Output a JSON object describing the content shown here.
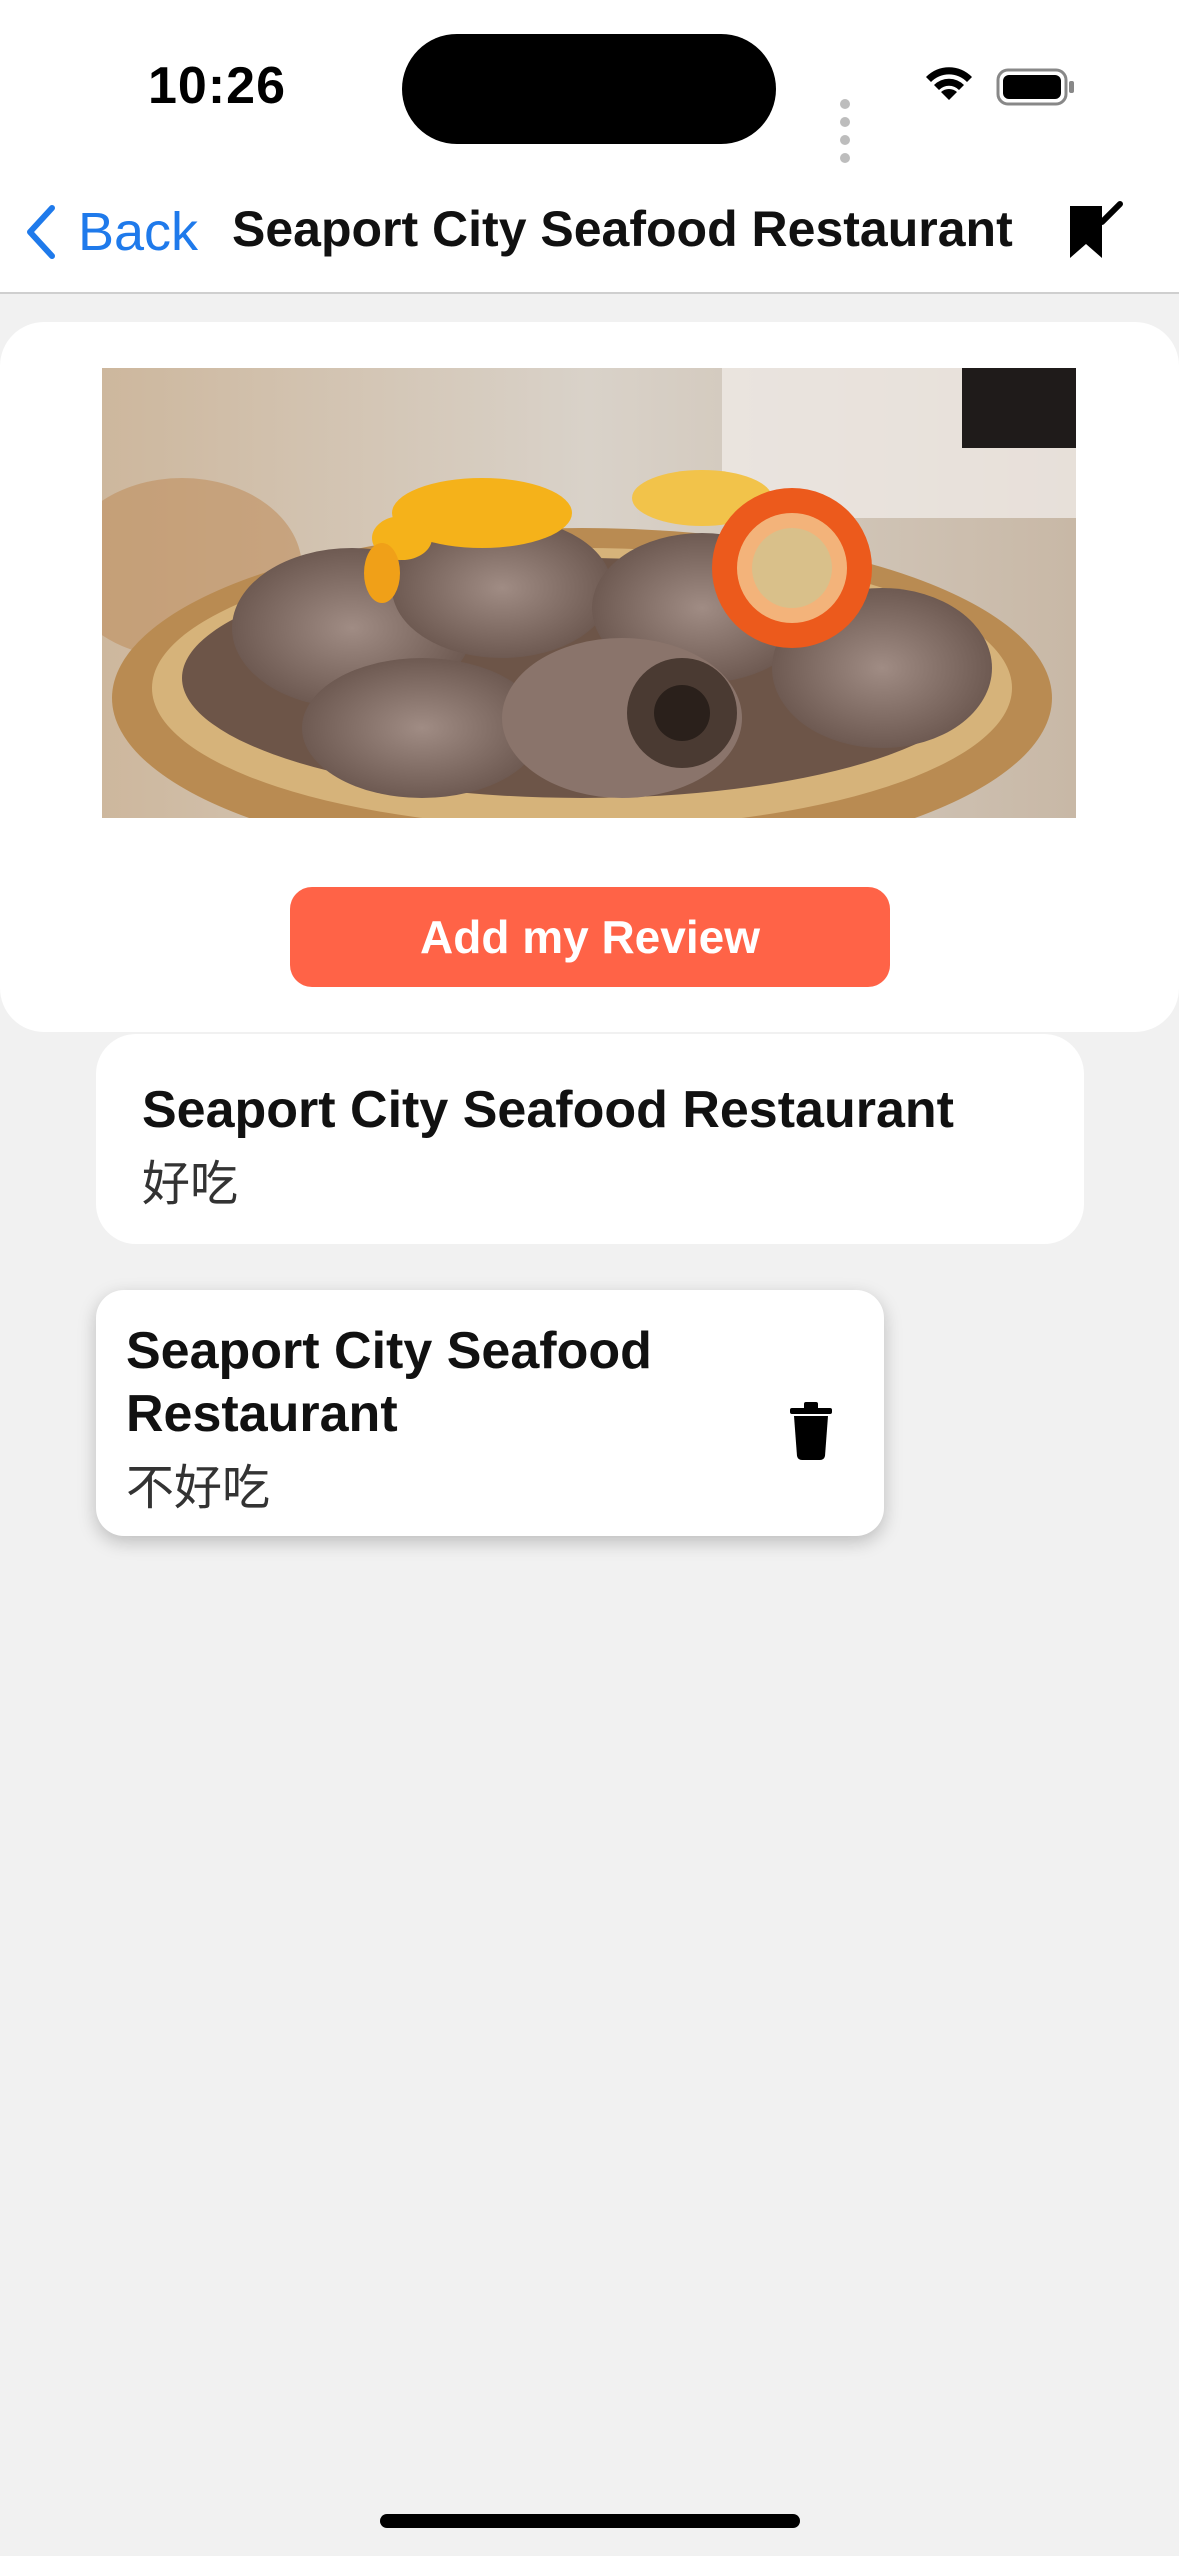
{
  "status_bar": {
    "time": "10:26"
  },
  "nav": {
    "back_label": "Back",
    "title": "Seaport City Seafood Restaurant"
  },
  "hero": {
    "add_review_label": "Add my Review"
  },
  "reviews": [
    {
      "restaurant": "Seaport City Seafood Restaurant",
      "text": "好吃"
    },
    {
      "restaurant": "Seaport City Seafood Restaurant",
      "text": "不好吃"
    }
  ],
  "colors": {
    "accent_blue": "#1f7aeb",
    "button": "#ff6347",
    "background": "#f1f1f1"
  },
  "icons": {
    "back": "chevron-left-icon",
    "bookmark": "bookmark-check-icon",
    "delete": "trash-icon",
    "wifi": "wifi-icon",
    "battery": "battery-icon",
    "signal": "signal-dots-icon"
  }
}
